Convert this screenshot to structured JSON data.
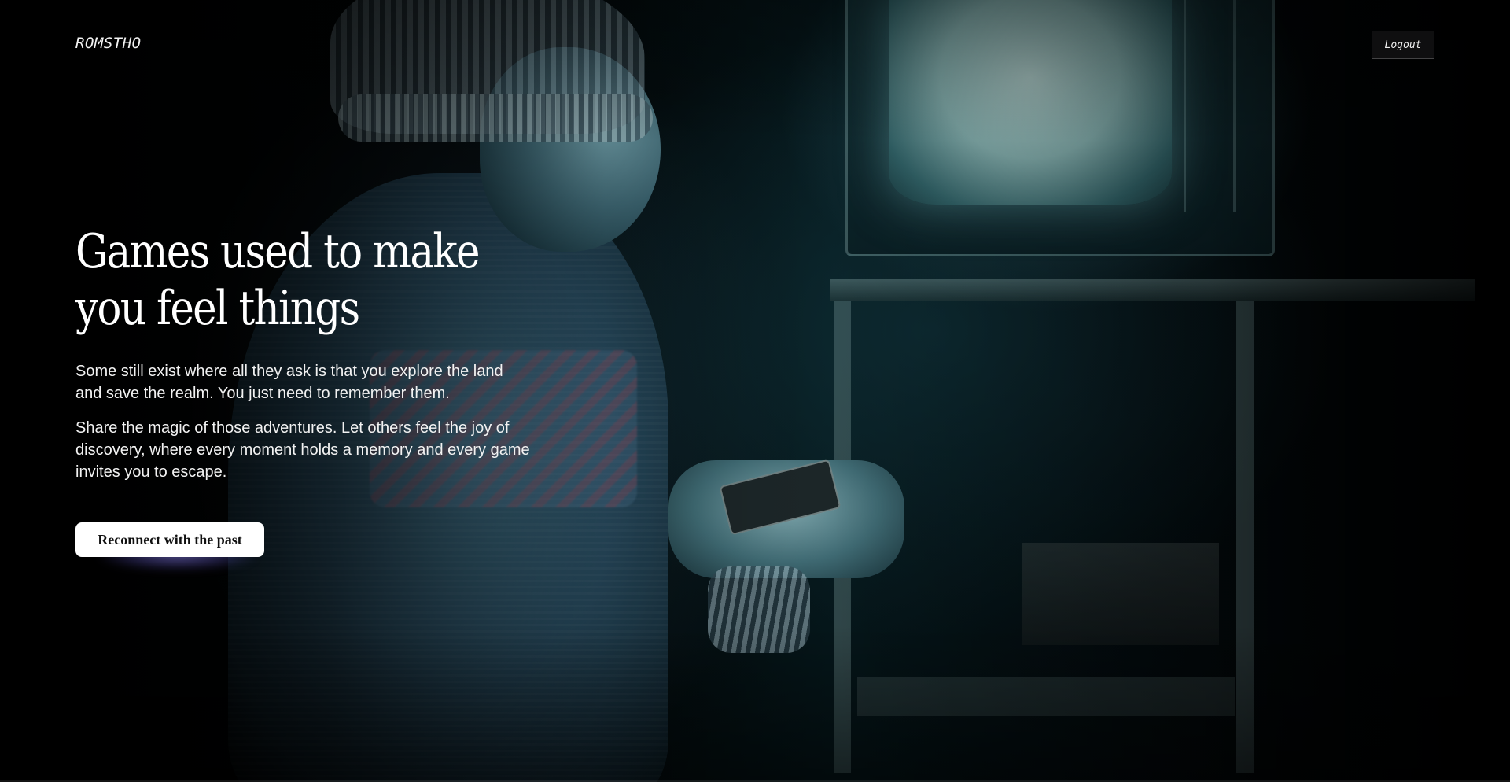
{
  "header": {
    "logo_text": "ROMSTHO",
    "logout_label": "Logout"
  },
  "hero": {
    "title_line1": "Games used to make",
    "title_line2": "you feel things",
    "paragraph1": "Some still exist where all they ask is that you explore the land and save the realm. You just need to remember them.",
    "paragraph2": "Share the magic of those adventures. Let others feel the joy of discovery, where every moment holds a memory and every game invites you to escape.",
    "cta_label": "Reconnect with the past"
  },
  "colors": {
    "background": "#000000",
    "text": "#ffffff",
    "cta_background": "#ffffff",
    "cta_text": "#111111",
    "cta_glow": "#9a8cff"
  }
}
